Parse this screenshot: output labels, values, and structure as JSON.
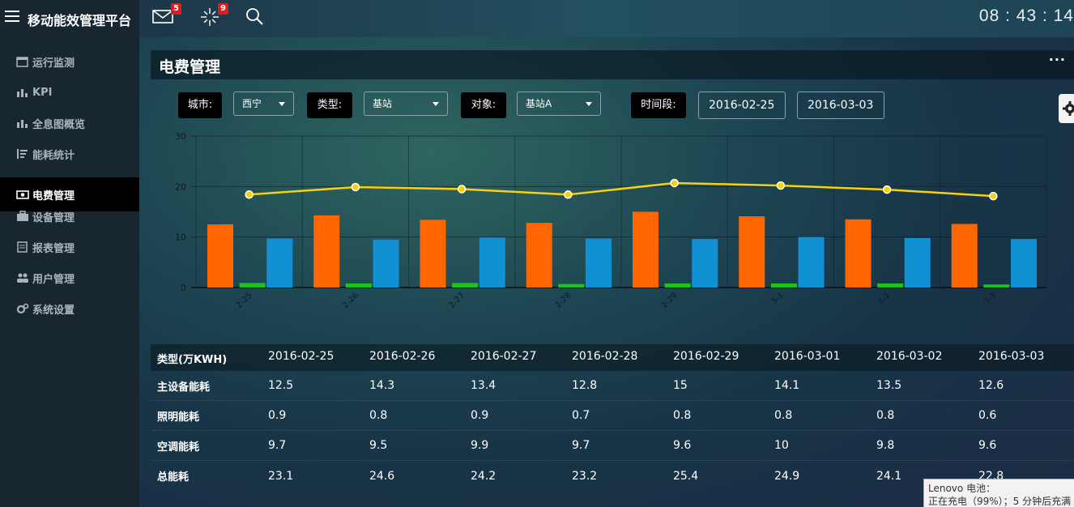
{
  "app": {
    "title": "移动能效管理平台",
    "mail_badge": "5",
    "alert_badge": "9",
    "clock": "08 : 43 : 14"
  },
  "sidebar": {
    "items": [
      {
        "label": "运行监测",
        "icon": "calendar-icon",
        "active": false
      },
      {
        "label": "KPI",
        "icon": "bar-chart-icon",
        "active": false
      },
      {
        "label": "全息图概览",
        "icon": "bar-chart-icon",
        "active": false
      },
      {
        "label": "能耗统计",
        "icon": "sort-list-icon",
        "active": false
      },
      {
        "label": "电费管理",
        "icon": "money-icon",
        "active": true
      },
      {
        "label": "设备管理",
        "icon": "briefcase-icon",
        "active": false
      },
      {
        "label": "报表管理",
        "icon": "document-icon",
        "active": false
      },
      {
        "label": "用户管理",
        "icon": "users-icon",
        "active": false
      },
      {
        "label": "系统设置",
        "icon": "gears-icon",
        "active": false
      }
    ]
  },
  "panel": {
    "title": "电费管理",
    "menu": "···",
    "filters": {
      "city_label": "城市:",
      "city_value": "西宁",
      "type_label": "类型:",
      "type_value": "基站",
      "object_label": "对象:",
      "object_value": "基站A",
      "period_label": "时间段:",
      "start_date": "2016-02-25",
      "end_date": "2016-03-03"
    }
  },
  "chart_data": {
    "type": "bar",
    "categories": [
      "2-25",
      "2-26",
      "2-27",
      "2-28",
      "2-29",
      "3-1",
      "3-2",
      "3-3"
    ],
    "ylim": [
      0,
      30
    ],
    "yticks": [
      0,
      10,
      20,
      30
    ],
    "grid": true,
    "series": [
      {
        "kind": "bar",
        "color": "#ff6600",
        "values": [
          12.5,
          14.3,
          13.4,
          12.8,
          15,
          14.1,
          13.5,
          12.6
        ]
      },
      {
        "kind": "bar",
        "color": "#1ec21e",
        "values": [
          0.9,
          0.8,
          0.9,
          0.7,
          0.8,
          0.8,
          0.8,
          0.6
        ]
      },
      {
        "kind": "bar",
        "color": "#1190d4",
        "values": [
          9.7,
          9.5,
          9.9,
          9.7,
          9.6,
          10,
          9.8,
          9.6
        ]
      },
      {
        "kind": "line",
        "color": "#f5d20c",
        "values": [
          18.4,
          19.9,
          19.5,
          18.4,
          20.7,
          20.2,
          19.4,
          18.1
        ]
      }
    ]
  },
  "table": {
    "header": [
      "类型(万KWH)",
      "2016-02-25",
      "2016-02-26",
      "2016-02-27",
      "2016-02-28",
      "2016-02-29",
      "2016-03-01",
      "2016-03-02",
      "2016-03-03"
    ],
    "rows": [
      {
        "label": "主设备能耗",
        "values": [
          "12.5",
          "14.3",
          "13.4",
          "12.8",
          "15",
          "14.1",
          "13.5",
          "12.6"
        ]
      },
      {
        "label": "照明能耗",
        "values": [
          "0.9",
          "0.8",
          "0.9",
          "0.7",
          "0.8",
          "0.8",
          "0.8",
          "0.6"
        ]
      },
      {
        "label": "空调能耗",
        "values": [
          "9.7",
          "9.5",
          "9.9",
          "9.7",
          "9.6",
          "10",
          "9.8",
          "9.6"
        ]
      },
      {
        "label": "总能耗",
        "values": [
          "23.1",
          "24.6",
          "24.2",
          "23.2",
          "25.4",
          "24.9",
          "24.1",
          "22.8"
        ]
      }
    ]
  },
  "tooltip": {
    "line1": "Lenovo 电池：",
    "line2": "正在充电（99%）；5 分钟后充满"
  }
}
